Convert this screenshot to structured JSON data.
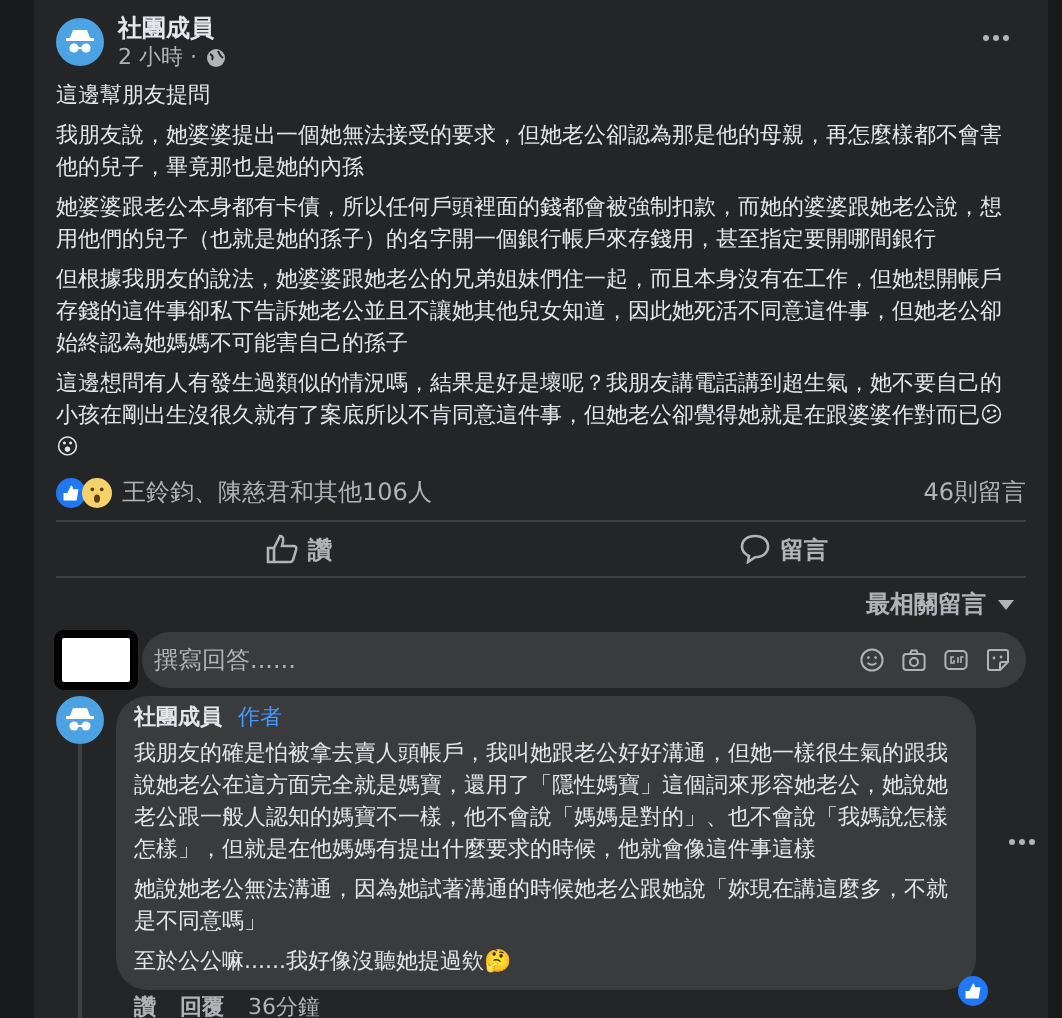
{
  "post": {
    "author": "社團成員",
    "time": "2 小時 ·",
    "paragraphs": [
      "這邊幫朋友提問",
      "我朋友說，她婆婆提出一個她無法接受的要求，但她老公卻認為那是他的母親，再怎麼樣都不會害他的兒子，畢竟那也是她的內孫",
      "她婆婆跟老公本身都有卡債，所以任何戶頭裡面的錢都會被強制扣款，而她的婆婆跟她老公說，想用他們的兒子（也就是她的孫子）的名字開一個銀行帳戶來存錢用，甚至指定要開哪間銀行",
      "但根據我朋友的說法，她婆婆跟她老公的兄弟姐妹們住一起，而且本身沒有在工作，但她想開帳戶存錢的這件事卻私下告訴她老公並且不讓她其他兒女知道，因此她死活不同意這件事，但她老公卻始終認為她媽媽不可能害自己的孫子",
      "這邊想問有人有發生過類似的情況嗎，結果是好是壞呢？我朋友講電話講到超生氣，她不要自己的小孩在剛出生沒很久就有了案底所以不肯同意這件事，但她老公卻覺得她就是在跟婆婆作對而已😕😮"
    ],
    "reactions": "王鈴鈞、陳慈君和其他106人",
    "comment_count": "46則留言",
    "actions": [
      {
        "kind": "like",
        "label": "讚"
      },
      {
        "kind": "comment",
        "label": "留言"
      }
    ]
  },
  "sort": "最相關留言",
  "reply": {
    "placeholder": "撰寫回答......"
  },
  "comment": {
    "author": "社團成員",
    "badge": "作者",
    "paragraphs": [
      "我朋友的確是怕被拿去賣人頭帳戶，我叫她跟老公好好溝通，但她一樣很生氣的跟我說她老公在這方面完全就是媽寶，還用了「隱性媽寶」這個詞來形容她老公，她說她老公跟一般人認知的媽寶不一樣，他不會說「媽媽是對的」、也不會說「我媽說怎樣怎樣」，但就是在他媽媽有提出什麼要求的時候，他就會像這件事這樣",
      "她說她老公無法溝通，因為她試著溝通的時候她老公跟她說「妳現在講這麼多，不就是不同意嗎」",
      "至於公公嘛......我好像沒聽她提過欸🤔"
    ],
    "actions": [
      "讚",
      "回覆"
    ],
    "time": "36分鐘"
  }
}
